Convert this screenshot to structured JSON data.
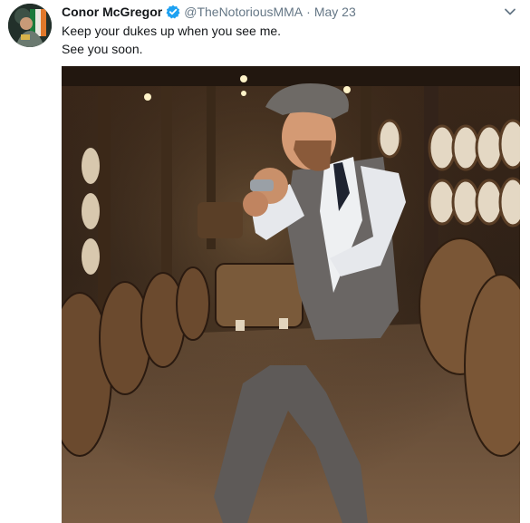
{
  "tweet": {
    "author_name": "Conor McGregor",
    "handle": "@TheNotoriousMMA",
    "separator": "·",
    "date": "May 23",
    "lines": [
      "Keep your dukes up when you see me.",
      "See you soon."
    ]
  },
  "icons": {
    "verified": "verified-badge-icon",
    "caret": "chevron-down-icon"
  },
  "colors": {
    "name": "#14171a",
    "secondary": "#657786",
    "verified": "#1da1f2"
  }
}
